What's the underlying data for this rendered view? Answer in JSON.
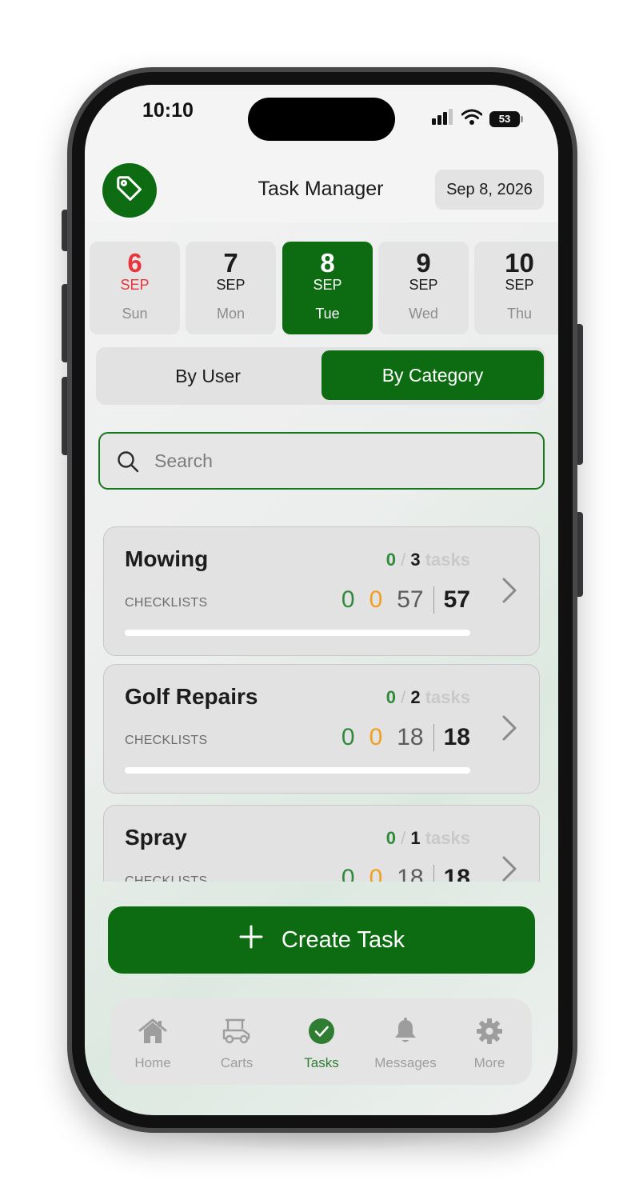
{
  "status_bar": {
    "time": "10:10",
    "battery": "53"
  },
  "header": {
    "title": "Task Manager",
    "date": "Sep 8, 2026"
  },
  "days": [
    {
      "num": "6",
      "month": "SEP",
      "weekday": "Sun",
      "state": "weekend"
    },
    {
      "num": "7",
      "month": "SEP",
      "weekday": "Mon",
      "state": "normal"
    },
    {
      "num": "8",
      "month": "SEP",
      "weekday": "Tue",
      "state": "selected"
    },
    {
      "num": "9",
      "month": "SEP",
      "weekday": "Wed",
      "state": "normal"
    },
    {
      "num": "10",
      "month": "SEP",
      "weekday": "Thu",
      "state": "normal"
    }
  ],
  "segmented": {
    "by_user": "By User",
    "by_category": "By Category",
    "selected": "By Category"
  },
  "search": {
    "placeholder": "Search",
    "value": ""
  },
  "categories": [
    {
      "name": "Mowing",
      "tasks_done": "0",
      "tasks_total": "3",
      "tasks_unit": "tasks",
      "checklists_label": "CHECKLISTS",
      "green": "0",
      "orange": "0",
      "gray": "57",
      "total": "57"
    },
    {
      "name": "Golf Repairs",
      "tasks_done": "0",
      "tasks_total": "2",
      "tasks_unit": "tasks",
      "checklists_label": "CHECKLISTS",
      "green": "0",
      "orange": "0",
      "gray": "18",
      "total": "18"
    },
    {
      "name": "Spray",
      "tasks_done": "0",
      "tasks_total": "1",
      "tasks_unit": "tasks",
      "checklists_label": "CHECKLISTS",
      "green": "0",
      "orange": "0",
      "gray": "18",
      "total": "18"
    }
  ],
  "create_button": {
    "label": "Create Task"
  },
  "tabbar": {
    "items": [
      {
        "label": "Home",
        "icon": "home-icon"
      },
      {
        "label": "Carts",
        "icon": "golf-cart-icon"
      },
      {
        "label": "Tasks",
        "icon": "check-circle-icon",
        "active": true
      },
      {
        "label": "Messages",
        "icon": "bell-icon"
      },
      {
        "label": "More",
        "icon": "gear-icon"
      }
    ]
  },
  "colors": {
    "brand_green": "#0d6c12",
    "accent_green": "#2e8b3a",
    "weekend_red": "#e8343a",
    "pending_orange": "#f0a020"
  }
}
